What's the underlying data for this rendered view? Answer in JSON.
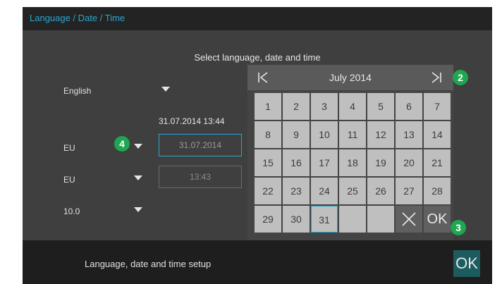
{
  "header": {
    "title": "Language / Date / Time"
  },
  "prompt": "Select language, date and time",
  "settings": {
    "language": "English",
    "date_format": "EU",
    "time_format": "EU",
    "timezone": "10.0"
  },
  "current_datetime": "31.07.2014 13:44",
  "date_field": {
    "value": "31.07.2014"
  },
  "time_field": {
    "value": "13:43"
  },
  "calendar": {
    "month_label": "July 2014",
    "days": [
      "1",
      "2",
      "3",
      "4",
      "5",
      "6",
      "7",
      "8",
      "9",
      "10",
      "11",
      "12",
      "13",
      "14",
      "15",
      "16",
      "17",
      "18",
      "19",
      "20",
      "21",
      "22",
      "23",
      "24",
      "25",
      "26",
      "27",
      "28",
      "29",
      "30",
      "31"
    ],
    "selected_day": "31",
    "ok_label": "OK"
  },
  "footer": {
    "text": "Language, date and time setup",
    "ok_label": "OK"
  },
  "badges": [
    "2",
    "3",
    "4"
  ],
  "colors": {
    "accent": "#2aa6cf",
    "badge": "#1ea650",
    "ok_button": "#1c5c5e"
  },
  "icons": [
    "first-page-icon",
    "last-page-icon",
    "close-icon",
    "chevron-down-icon"
  ]
}
